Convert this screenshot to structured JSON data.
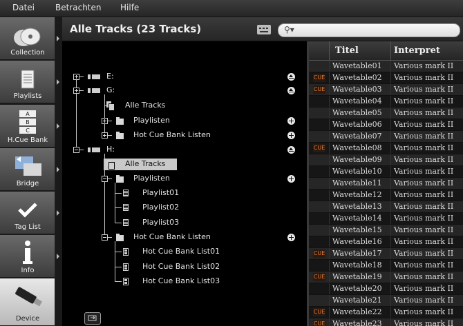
{
  "menu": [
    "Datei",
    "Betrachten",
    "Hilfe"
  ],
  "header": {
    "title": "Alle Tracks (23 Tracks)"
  },
  "sidebar": [
    {
      "label": "Collection",
      "icon": "collection-icon",
      "active": false
    },
    {
      "label": "Playlists",
      "icon": "playlist-icon",
      "active": false
    },
    {
      "label": "H.Cue Bank",
      "icon": "hot-cue-bank-icon",
      "active": false
    },
    {
      "label": "Bridge",
      "icon": "bridge-icon",
      "active": false
    },
    {
      "label": "Tag List",
      "icon": "checkmark-icon",
      "active": false
    },
    {
      "label": "Info",
      "icon": "info-icon",
      "active": false
    },
    {
      "label": "Device",
      "icon": "usb-device-icon",
      "active": true
    }
  ],
  "tree": [
    {
      "label": "E:",
      "type": "drive",
      "expander": "plus",
      "action": "eject"
    },
    {
      "label": "G:",
      "type": "drive",
      "expander": "plus",
      "action": "eject"
    },
    {
      "label": "Alle Tracks",
      "type": "tracks"
    },
    {
      "label": "Playlisten",
      "type": "folder",
      "expander": "plus",
      "action": "add"
    },
    {
      "label": "Hot Cue Bank Listen",
      "type": "folder",
      "expander": "plus",
      "action": "add"
    },
    {
      "label": "H:",
      "type": "drive",
      "expander": "minus",
      "action": "eject"
    },
    {
      "label": "Alle Tracks",
      "type": "tracks",
      "selected": true
    },
    {
      "label": "Playlisten",
      "type": "folder",
      "expander": "minus",
      "action": "add"
    },
    {
      "label": "Playlist01",
      "type": "playlist"
    },
    {
      "label": "Playlist02",
      "type": "playlist"
    },
    {
      "label": "Playlist03",
      "type": "playlist"
    },
    {
      "label": "Hot Cue Bank Listen",
      "type": "folder",
      "expander": "minus",
      "action": "add"
    },
    {
      "label": "Hot Cue Bank List01",
      "type": "hotcue"
    },
    {
      "label": "Hot Cue Bank List02",
      "type": "hotcue"
    },
    {
      "label": "Hot Cue Bank List03",
      "type": "hotcue"
    }
  ],
  "table": {
    "columns": [
      "Titel",
      "Interpret"
    ],
    "cue_label": "CUE",
    "rows": [
      {
        "title": "Wavetable01",
        "artist": "Various mark II",
        "cue": false
      },
      {
        "title": "Wavetable02",
        "artist": "Various mark II",
        "cue": true
      },
      {
        "title": "Wavetable03",
        "artist": "Various mark II",
        "cue": true
      },
      {
        "title": "Wavetable04",
        "artist": "Various mark II",
        "cue": false
      },
      {
        "title": "Wavetable05",
        "artist": "Various mark II",
        "cue": false
      },
      {
        "title": "Wavetable06",
        "artist": "Various mark II",
        "cue": false
      },
      {
        "title": "Wavetable07",
        "artist": "Various mark II",
        "cue": false
      },
      {
        "title": "Wavetable08",
        "artist": "Various mark II",
        "cue": true
      },
      {
        "title": "Wavetable09",
        "artist": "Various mark II",
        "cue": false
      },
      {
        "title": "Wavetable10",
        "artist": "Various mark II",
        "cue": false
      },
      {
        "title": "Wavetable11",
        "artist": "Various mark II",
        "cue": false
      },
      {
        "title": "Wavetable12",
        "artist": "Various mark II",
        "cue": false
      },
      {
        "title": "Wavetable13",
        "artist": "Various mark II",
        "cue": false
      },
      {
        "title": "Wavetable14",
        "artist": "Various mark II",
        "cue": false
      },
      {
        "title": "Wavetable15",
        "artist": "Various mark II",
        "cue": false
      },
      {
        "title": "Wavetable16",
        "artist": "Various mark II",
        "cue": false
      },
      {
        "title": "Wavetable17",
        "artist": "Various mark II",
        "cue": true
      },
      {
        "title": "Wavetable18",
        "artist": "Various mark II",
        "cue": false
      },
      {
        "title": "Wavetable19",
        "artist": "Various mark II",
        "cue": true
      },
      {
        "title": "Wavetable20",
        "artist": "Various mark II",
        "cue": false
      },
      {
        "title": "Wavetable21",
        "artist": "Various mark II",
        "cue": false
      },
      {
        "title": "Wavetable22",
        "artist": "Various mark II",
        "cue": true
      },
      {
        "title": "Wavetable23",
        "artist": "Various mark II",
        "cue": true
      }
    ]
  },
  "colors": {
    "cue": "#e07830",
    "selected": "#c9c9c9"
  }
}
